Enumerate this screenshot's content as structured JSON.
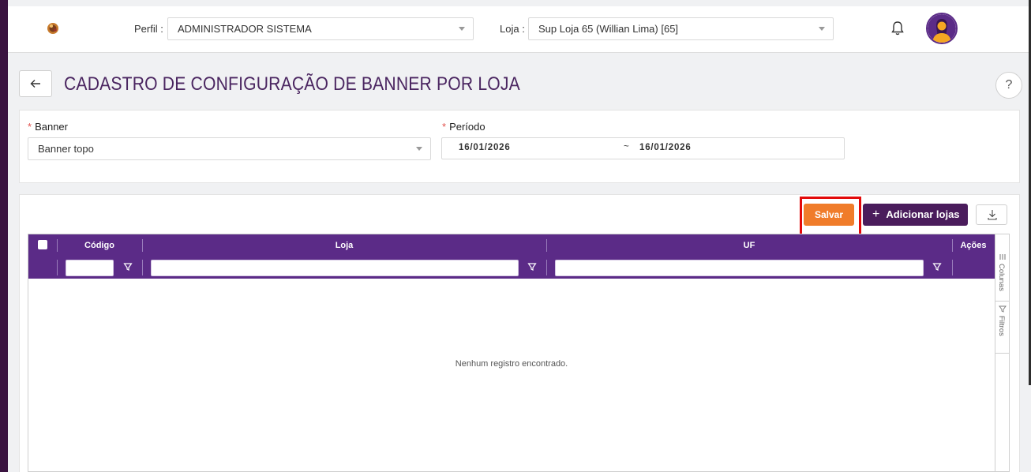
{
  "header": {
    "perfil_label": "Perfil :",
    "perfil_value": "ADMINISTRADOR SISTEMA",
    "loja_label": "Loja :",
    "loja_value": "Sup Loja 65 (Willian Lima) [65]"
  },
  "page": {
    "title": "CADASTRO DE CONFIGURAÇÃO DE BANNER POR LOJA",
    "help_label": "?"
  },
  "form": {
    "banner_label": "Banner",
    "banner_value": "Banner topo",
    "periodo_label": "Período",
    "periodo_start": "16/01/2026",
    "periodo_sep": "~",
    "periodo_end": "16/01/2026"
  },
  "toolbar": {
    "salvar_label": "Salvar",
    "add_label": "Adicionar lojas"
  },
  "grid": {
    "columns": [
      "Código",
      "Loja",
      "UF",
      "Ações"
    ],
    "empty_message": "Nenhum registro encontrado."
  },
  "side_panel": {
    "colunas_label": "Colunas",
    "filtros_label": "Filtros"
  },
  "colors": {
    "primary": "#5b2b87",
    "accent_orange": "#f07c2a",
    "dark_purple": "#4a1c5c",
    "highlight_red": "#e30a0a"
  }
}
